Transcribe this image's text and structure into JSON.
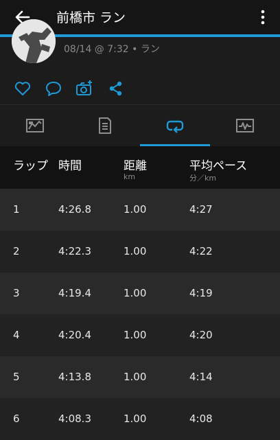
{
  "header": {
    "title": "前橋市 ラン"
  },
  "activity": {
    "subtitle": "08/14 @ 7:32 • ラン"
  },
  "table": {
    "headers": {
      "lap": "ラップ",
      "time": "時間",
      "distance": "距離",
      "pace": "平均ペース"
    },
    "units": {
      "distance": "km",
      "pace": "分／km"
    },
    "rows": [
      {
        "lap": "1",
        "time": "4:26.8",
        "distance": "1.00",
        "pace": "4:27"
      },
      {
        "lap": "2",
        "time": "4:22.3",
        "distance": "1.00",
        "pace": "4:22"
      },
      {
        "lap": "3",
        "time": "4:19.4",
        "distance": "1.00",
        "pace": "4:19"
      },
      {
        "lap": "4",
        "time": "4:20.4",
        "distance": "1.00",
        "pace": "4:20"
      },
      {
        "lap": "5",
        "time": "4:13.8",
        "distance": "1.00",
        "pace": "4:14"
      },
      {
        "lap": "6",
        "time": "4:08.3",
        "distance": "1.00",
        "pace": "4:08"
      }
    ]
  },
  "tabs": [
    {
      "name": "overview",
      "icon": "map-icon"
    },
    {
      "name": "details",
      "icon": "document-icon"
    },
    {
      "name": "laps",
      "icon": "lap-loop-icon",
      "active": true
    },
    {
      "name": "charts",
      "icon": "chart-icon"
    }
  ],
  "colors": {
    "accent": "#1f9ad6",
    "background": "#1f1f1f",
    "header": "#151515"
  }
}
